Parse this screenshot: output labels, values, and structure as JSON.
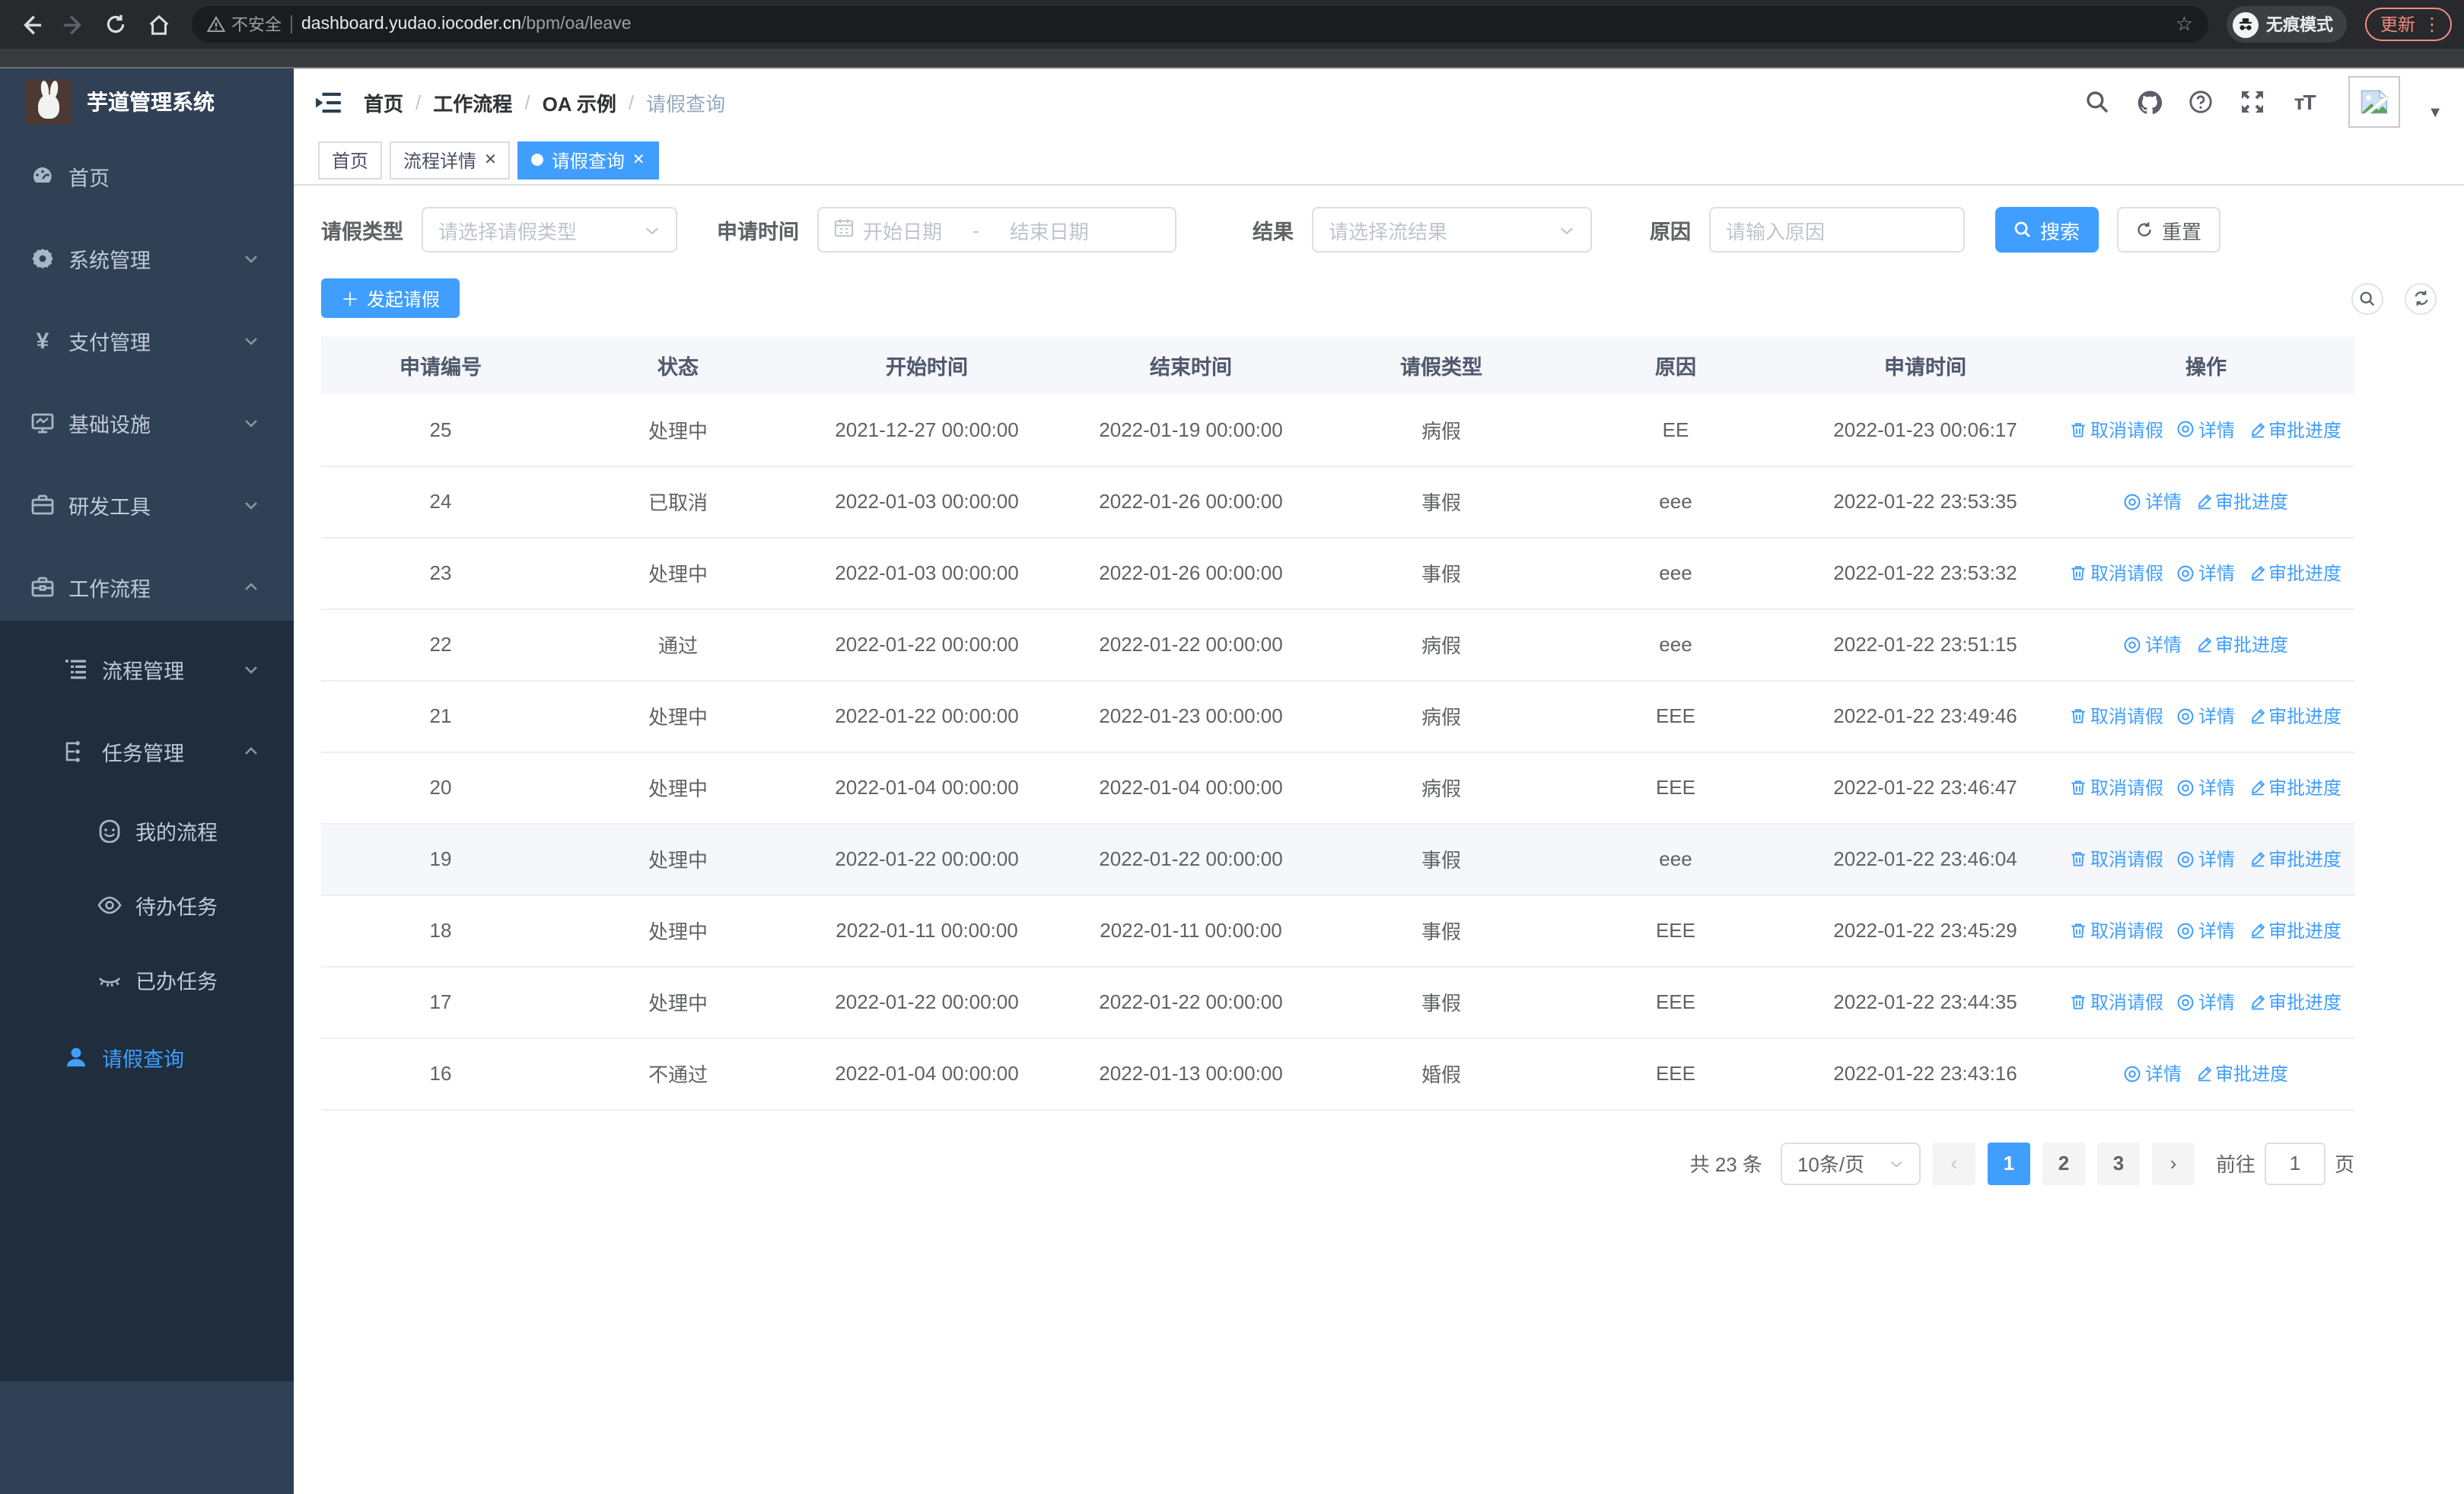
{
  "browser": {
    "security_label": "不安全",
    "url_host": "dashboard.yudao.iocoder.cn",
    "url_path": "/bpm/oa/leave",
    "incognito_label": "无痕模式",
    "update_label": "更新"
  },
  "sidebar": {
    "logo_title": "芋道管理系统",
    "items": [
      {
        "label": "首页",
        "icon": "dashboard-icon",
        "level": 1,
        "chevron": "none",
        "active": false
      },
      {
        "label": "系统管理",
        "icon": "gear-icon",
        "level": 1,
        "chevron": "down",
        "active": false
      },
      {
        "label": "支付管理",
        "icon": "yen-icon",
        "level": 1,
        "chevron": "down",
        "active": false
      },
      {
        "label": "基础设施",
        "icon": "monitor-icon",
        "level": 1,
        "chevron": "down",
        "active": false
      },
      {
        "label": "研发工具",
        "icon": "toolbox-icon",
        "level": 1,
        "chevron": "down",
        "active": false
      },
      {
        "label": "工作流程",
        "icon": "briefcase-icon",
        "level": 1,
        "chevron": "up",
        "active": false
      },
      {
        "label": "流程管理",
        "icon": "list-tree-icon",
        "level": 2,
        "chevron": "down",
        "active": false
      },
      {
        "label": "任务管理",
        "icon": "flow-icon",
        "level": 2,
        "chevron": "up",
        "active": false
      },
      {
        "label": "我的流程",
        "icon": "robot-face-icon",
        "level": 3,
        "chevron": "none",
        "active": false
      },
      {
        "label": "待办任务",
        "icon": "eye-open-icon",
        "level": 3,
        "chevron": "none",
        "active": false
      },
      {
        "label": "已办任务",
        "icon": "eye-closed-icon",
        "level": 3,
        "chevron": "none",
        "active": false
      },
      {
        "label": "请假查询",
        "icon": "user-icon",
        "level": 2,
        "chevron": "none",
        "active": true
      }
    ]
  },
  "header": {
    "breadcrumb": [
      "首页",
      "工作流程",
      "OA 示例",
      "请假查询"
    ],
    "separator": "/"
  },
  "tabs": [
    {
      "label": "首页",
      "closable": false,
      "active": false
    },
    {
      "label": "流程详情",
      "closable": true,
      "active": false
    },
    {
      "label": "请假查询",
      "closable": true,
      "active": true
    }
  ],
  "filters": {
    "leave_type_label": "请假类型",
    "leave_type_placeholder": "请选择请假类型",
    "apply_time_label": "申请时间",
    "start_date_placeholder": "开始日期",
    "range_separator": "-",
    "end_date_placeholder": "结束日期",
    "result_label": "结果",
    "result_placeholder": "请选择流结果",
    "reason_label": "原因",
    "reason_placeholder": "请输入原因",
    "search_label": "搜索",
    "reset_label": "重置"
  },
  "toolbar": {
    "create_label": "发起请假"
  },
  "table": {
    "columns": [
      "申请编号",
      "状态",
      "开始时间",
      "结束时间",
      "请假类型",
      "原因",
      "申请时间",
      "操作"
    ],
    "action_labels": {
      "cancel": "取消请假",
      "detail": "详情",
      "progress": "审批进度"
    },
    "rows": [
      {
        "id": "25",
        "status": "处理中",
        "start": "2021-12-27 00:00:00",
        "end": "2022-01-19 00:00:00",
        "type": "病假",
        "reason": "EE",
        "apply": "2022-01-23 00:06:17",
        "cancel": true,
        "highlight": false
      },
      {
        "id": "24",
        "status": "已取消",
        "start": "2022-01-03 00:00:00",
        "end": "2022-01-26 00:00:00",
        "type": "事假",
        "reason": "eee",
        "apply": "2022-01-22 23:53:35",
        "cancel": false,
        "highlight": false
      },
      {
        "id": "23",
        "status": "处理中",
        "start": "2022-01-03 00:00:00",
        "end": "2022-01-26 00:00:00",
        "type": "事假",
        "reason": "eee",
        "apply": "2022-01-22 23:53:32",
        "cancel": true,
        "highlight": false
      },
      {
        "id": "22",
        "status": "通过",
        "start": "2022-01-22 00:00:00",
        "end": "2022-01-22 00:00:00",
        "type": "病假",
        "reason": "eee",
        "apply": "2022-01-22 23:51:15",
        "cancel": false,
        "highlight": false
      },
      {
        "id": "21",
        "status": "处理中",
        "start": "2022-01-22 00:00:00",
        "end": "2022-01-23 00:00:00",
        "type": "病假",
        "reason": "EEE",
        "apply": "2022-01-22 23:49:46",
        "cancel": true,
        "highlight": false
      },
      {
        "id": "20",
        "status": "处理中",
        "start": "2022-01-04 00:00:00",
        "end": "2022-01-04 00:00:00",
        "type": "病假",
        "reason": "EEE",
        "apply": "2022-01-22 23:46:47",
        "cancel": true,
        "highlight": false
      },
      {
        "id": "19",
        "status": "处理中",
        "start": "2022-01-22 00:00:00",
        "end": "2022-01-22 00:00:00",
        "type": "事假",
        "reason": "eee",
        "apply": "2022-01-22 23:46:04",
        "cancel": true,
        "highlight": true
      },
      {
        "id": "18",
        "status": "处理中",
        "start": "2022-01-11 00:00:00",
        "end": "2022-01-11 00:00:00",
        "type": "事假",
        "reason": "EEE",
        "apply": "2022-01-22 23:45:29",
        "cancel": true,
        "highlight": false
      },
      {
        "id": "17",
        "status": "处理中",
        "start": "2022-01-22 00:00:00",
        "end": "2022-01-22 00:00:00",
        "type": "事假",
        "reason": "EEE",
        "apply": "2022-01-22 23:44:35",
        "cancel": true,
        "highlight": false
      },
      {
        "id": "16",
        "status": "不通过",
        "start": "2022-01-04 00:00:00",
        "end": "2022-01-13 00:00:00",
        "type": "婚假",
        "reason": "EEE",
        "apply": "2022-01-22 23:43:16",
        "cancel": false,
        "highlight": false
      }
    ]
  },
  "pagination": {
    "total_label": "共 23 条",
    "page_size_label": "10条/页",
    "pages": [
      "1",
      "2",
      "3"
    ],
    "active_page": "1",
    "goto_label": "前往",
    "goto_value": "1",
    "page_suffix": "页"
  },
  "colors": {
    "accent": "#409EFF",
    "sidebar_bg": "#304156",
    "submenu_bg": "#1F2D3D",
    "table_header_bg": "#F5F7FA",
    "update_badge": "#F28B82"
  }
}
